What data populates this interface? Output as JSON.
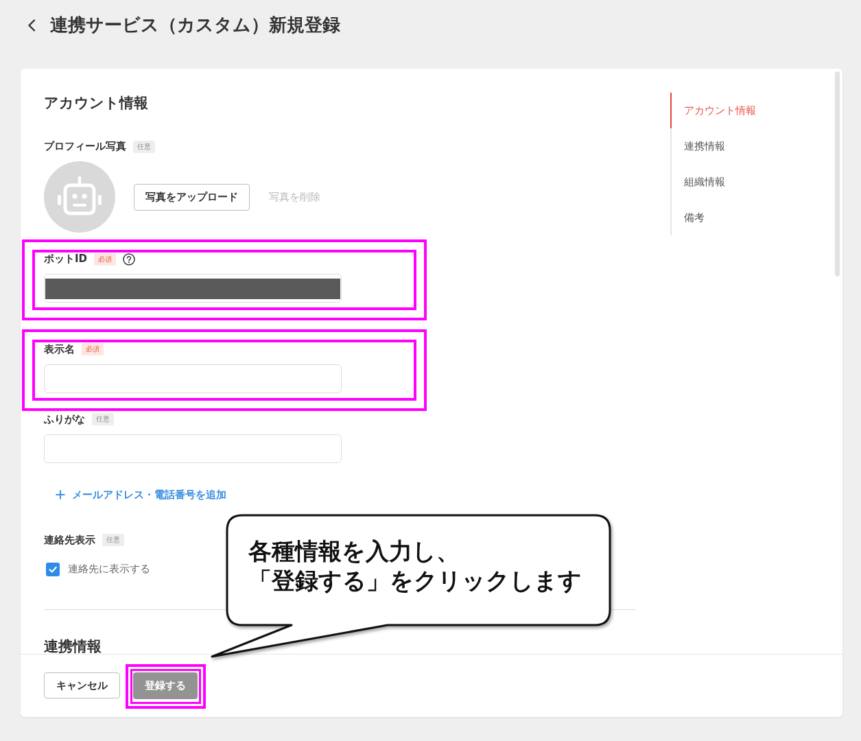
{
  "header": {
    "title": "連携サービス（カスタム）新規登録"
  },
  "account_section": {
    "title": "アカウント情報",
    "profile_photo": {
      "label": "プロフィール写真",
      "badge": {
        "text": "任意",
        "kind": "optional"
      },
      "upload_button": {
        "label": "写真をアップロード"
      },
      "delete_button": {
        "label": "写真を削除",
        "disabled": true
      }
    },
    "fields": [
      {
        "label": "ボットID",
        "badge": {
          "text": "必須",
          "kind": "required"
        },
        "help": true,
        "redacted": true,
        "highlighted": true
      },
      {
        "label": "表示名",
        "badge": {
          "text": "必須",
          "kind": "required"
        },
        "help": false,
        "redacted": false,
        "highlighted": true
      },
      {
        "label": "ふりがな",
        "badge": {
          "text": "任意",
          "kind": "optional"
        },
        "help": false,
        "redacted": false,
        "highlighted": false
      }
    ],
    "add_link": {
      "label": "メールアドレス・電話番号を追加"
    },
    "contact_display": {
      "label": "連絡先表示",
      "badge": {
        "text": "任意",
        "kind": "optional"
      },
      "checkbox": {
        "label": "連絡先に表示する",
        "checked": true
      }
    }
  },
  "next_section": {
    "title": "連携情報"
  },
  "section_nav": {
    "items": [
      {
        "label": "アカウント情報",
        "selected": true
      },
      {
        "label": "連携情報",
        "selected": false
      },
      {
        "label": "組織情報",
        "selected": false
      },
      {
        "label": "備考",
        "selected": false
      }
    ]
  },
  "footer": {
    "buttons": [
      {
        "label": "キャンセル",
        "kind": "secondary",
        "disabled": false,
        "highlighted": false
      },
      {
        "label": "登録する",
        "kind": "primary",
        "disabled": true,
        "highlighted": true
      }
    ]
  },
  "callout": {
    "lines": [
      "各種情報を入力し、",
      "「登録する」をクリックします"
    ]
  }
}
